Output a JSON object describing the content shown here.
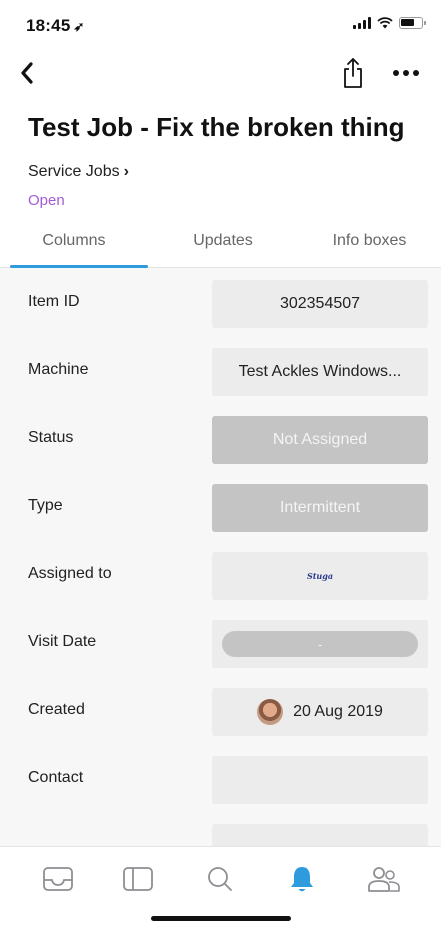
{
  "status_bar": {
    "time": "18:45",
    "location_glyph": "➶"
  },
  "nav": {
    "back_icon": "chevron-left-icon",
    "share_icon": "share-icon",
    "more_icon": "more-dots-icon"
  },
  "header": {
    "title": "Test Job - Fix the broken thing",
    "breadcrumb": "Service Jobs",
    "breadcrumb_chevron": "›",
    "state": "Open",
    "state_color": "#a25bd6"
  },
  "tabs": [
    {
      "label": "Columns",
      "active": true
    },
    {
      "label": "Updates",
      "active": false
    },
    {
      "label": "Info boxes",
      "active": false
    }
  ],
  "accent_color": "#2d9bdc",
  "rows": [
    {
      "label": "Item ID",
      "value": "302354507"
    },
    {
      "label": "Machine",
      "value": "Test Ackles Windows..."
    },
    {
      "label": "Status",
      "value": "Not Assigned"
    },
    {
      "label": "Type",
      "value": "Intermittent"
    },
    {
      "label": "Assigned to",
      "value": "Stuga"
    },
    {
      "label": "Visit Date",
      "value": "-"
    },
    {
      "label": "Created",
      "value": "20 Aug 2019"
    },
    {
      "label": "Contact",
      "value": ""
    }
  ],
  "tab_bar": {
    "items": [
      "inbox-icon",
      "boards-icon",
      "search-icon",
      "notifications-icon",
      "team-icon"
    ],
    "active": "notifications-icon",
    "active_color": "#2d9bdc",
    "inactive_color": "#8e8e93"
  }
}
